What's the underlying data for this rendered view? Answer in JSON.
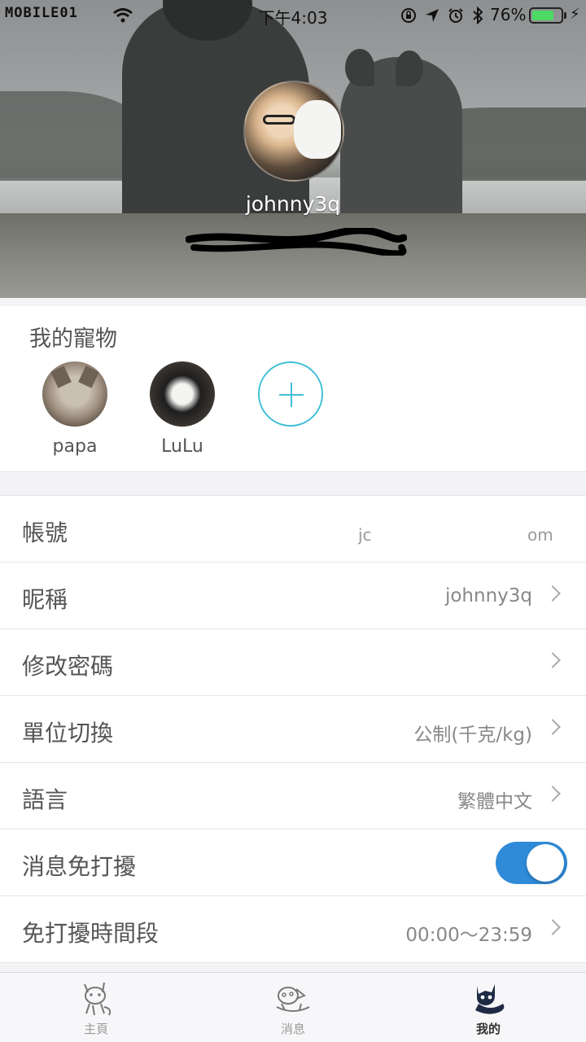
{
  "status_bar": {
    "carrier": "MOBILE01",
    "time": "下午4:03",
    "battery_percent": "76%",
    "battery_level": 0.76,
    "icons": [
      "wifi-icon",
      "rotation-lock-icon",
      "location-icon",
      "alarm-icon",
      "bluetooth-icon",
      "battery-icon",
      "charging-bolt-icon"
    ]
  },
  "profile": {
    "username": "johnny3q"
  },
  "pets": {
    "title": "我的寵物",
    "items": [
      {
        "name": "papa"
      },
      {
        "name": "LuLu"
      }
    ],
    "add_icon": "plus-icon"
  },
  "settings": {
    "account": {
      "label": "帳號",
      "value_fragments": [
        "jc",
        "om"
      ]
    },
    "nickname": {
      "label": "昵稱",
      "value": "johnny3q"
    },
    "password": {
      "label": "修改密碼"
    },
    "units": {
      "label": "單位切換",
      "value": "公制(千克/kg)"
    },
    "language": {
      "label": "語言",
      "value": "繁體中文"
    },
    "dnd": {
      "label": "消息免打擾",
      "enabled": true
    },
    "dnd_period": {
      "label": "免打擾時間段",
      "value": "00:00～23:59"
    }
  },
  "tabbar": {
    "tabs": [
      {
        "label": "主頁",
        "icon": "cat-home-icon",
        "active": false
      },
      {
        "label": "消息",
        "icon": "cat-message-icon",
        "active": false
      },
      {
        "label": "我的",
        "icon": "cat-profile-icon",
        "active": true
      }
    ]
  },
  "colors": {
    "accent": "#2f8bd8",
    "add_button": "#3fc0d8",
    "battery_green": "#4cd964"
  }
}
